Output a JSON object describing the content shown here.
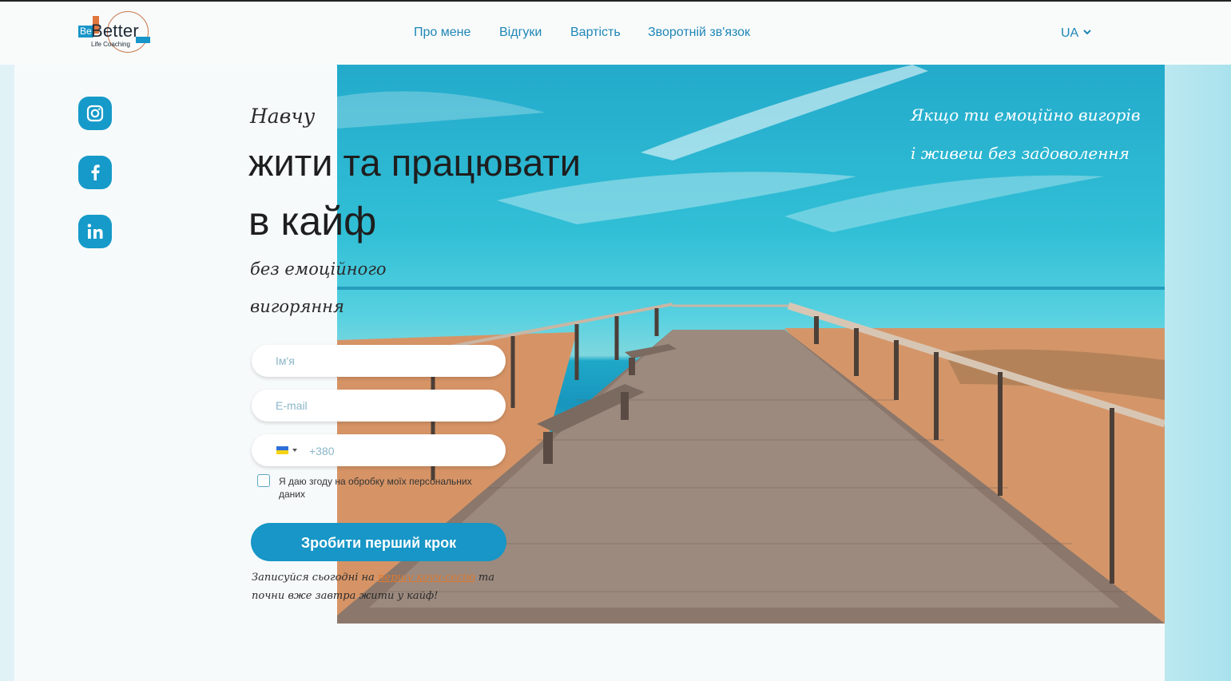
{
  "logo": {
    "mark_prefix": "Be",
    "mark_main": "Better",
    "tagline": "Life Coaching"
  },
  "nav": {
    "items": [
      "Про мене",
      "Відгуки",
      "Вартість",
      "Зворотній зв'язок"
    ],
    "language": "UA"
  },
  "social": [
    "instagram-icon",
    "facebook-icon",
    "linkedin-icon"
  ],
  "headline": {
    "intro": "Навчу",
    "line1": "жити та працювати",
    "line2": "в кайф",
    "sub1": "без емоційного",
    "sub2": "вигоряння"
  },
  "hero_text": {
    "line1": "Якщо ти емоційно вигорів",
    "line2": "і живеш без задоволення"
  },
  "form": {
    "name_placeholder": "Ім'я",
    "email_placeholder": "E-mail",
    "phone_placeholder": "+380",
    "consent": "Я даю згоду на обробку моїх персональних даних",
    "submit": "Зробити перший крок"
  },
  "note": {
    "before": "Записуйся сьогодні на ",
    "link": "першу коуч-сесію",
    "after": " та почни вже завтра жити у кайф!"
  },
  "colors": {
    "accent": "#1796c7",
    "nav_text": "#1f86b5",
    "link_orange": "#e07a2e"
  }
}
